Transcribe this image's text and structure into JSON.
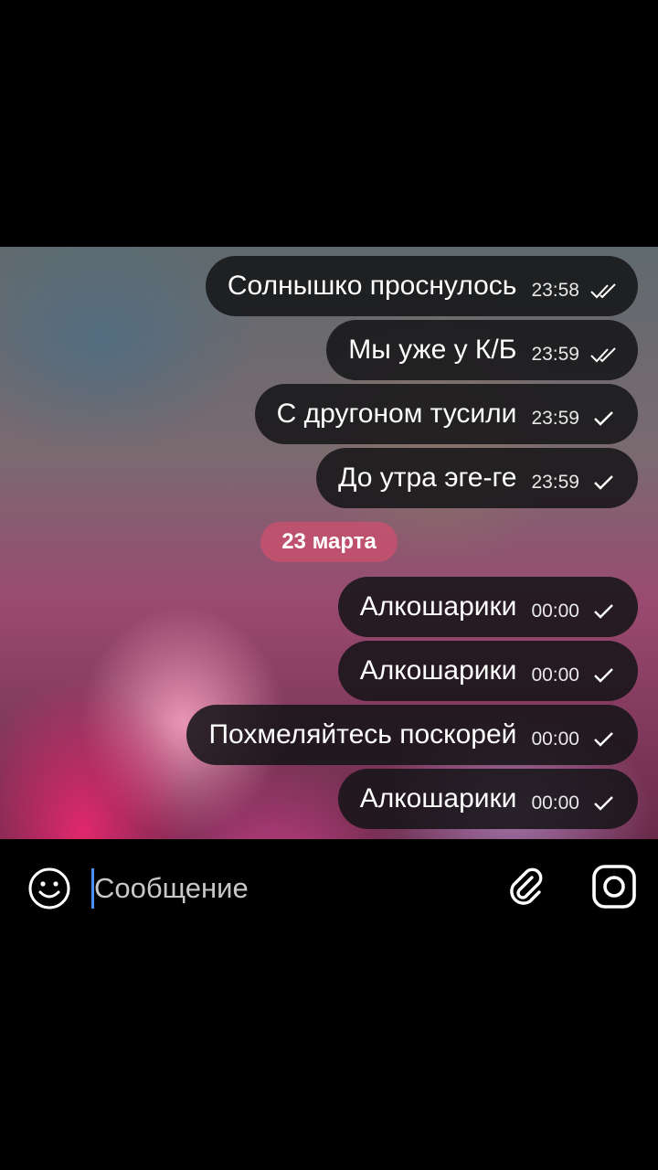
{
  "date_separator": "23 марта",
  "messages_before": [
    {
      "text": "Солнышко проснулось",
      "time": "23:58",
      "status": "read"
    },
    {
      "text": "Мы уже у К/Б",
      "time": "23:59",
      "status": "read"
    },
    {
      "text": "С другоном тусили",
      "time": "23:59",
      "status": "sent"
    },
    {
      "text": "До утра эге-ге",
      "time": "23:59",
      "status": "sent"
    }
  ],
  "messages_after": [
    {
      "text": "Алкошарики",
      "time": "00:00",
      "status": "sent"
    },
    {
      "text": "Алкошарики",
      "time": "00:00",
      "status": "sent"
    },
    {
      "text": "Похмеляйтесь поскорей",
      "time": "00:00",
      "status": "sent"
    },
    {
      "text": "Алкошарики",
      "time": "00:00",
      "status": "sent"
    }
  ],
  "input": {
    "placeholder": "Сообщение",
    "value": ""
  },
  "icons": {
    "emoji": "smiley-face-icon",
    "attach": "paperclip-icon",
    "camera": "camera-icon"
  },
  "colors": {
    "bubble_bg": "#141416",
    "date_pill_bg": "#c8506e",
    "cursor": "#4f8ef7",
    "background": "#000000"
  }
}
